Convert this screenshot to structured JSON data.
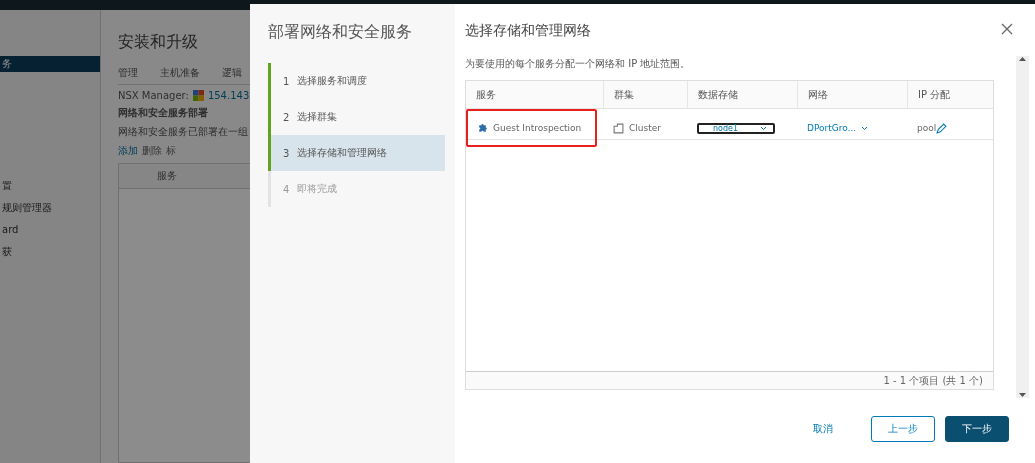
{
  "background": {
    "sidebar": {
      "items": [
        {
          "label": "务",
          "selected": true
        },
        {
          "label": "置",
          "selected": false
        },
        {
          "label": "规则管理器",
          "selected": false
        },
        {
          "label": "ard",
          "selected": false
        },
        {
          "label": "获",
          "selected": false
        }
      ]
    },
    "main": {
      "title": "安装和升级",
      "tabs": [
        "管理",
        "主机准备",
        "逻辑"
      ],
      "manager_label": "NSX Manager:",
      "manager_link": "154.143",
      "section_title": "网络和安全服务部署",
      "section_desc": "网络和安全服务已部署在一组",
      "toolbar": [
        {
          "label": "添加",
          "disabled": false
        },
        {
          "label": "删除",
          "disabled": true
        },
        {
          "label": "标",
          "disabled": true
        }
      ],
      "table_header": "服务"
    }
  },
  "dialog": {
    "title": "部署网络和安全服务",
    "steps": [
      {
        "number": "1",
        "label": "选择服务和调度",
        "selected": false,
        "done": true
      },
      {
        "number": "2",
        "label": "选择群集",
        "selected": false,
        "done": true
      },
      {
        "number": "3",
        "label": "选择存储和管理网络",
        "selected": true,
        "done": true
      },
      {
        "number": "4",
        "label": "即将完成",
        "selected": false,
        "done": false
      }
    ],
    "page_title": "选择存储和管理网络",
    "description": "为要使用的每个服务分配一个网络和 IP 地址范围。",
    "table": {
      "columns": [
        "服务",
        "群集",
        "数据存储",
        "网络",
        "IP 分配"
      ],
      "rows": [
        {
          "service": "Guest Introspection",
          "highlighted": true,
          "cluster": "Cluster",
          "datastore": "node1",
          "network": "DPortGro...",
          "ip": "pool"
        }
      ],
      "footer": "1 - 1 个项目 (共 1 个)"
    },
    "buttons": [
      {
        "label": "取消",
        "kind": "link"
      },
      {
        "label": "上一步",
        "kind": "outline"
      },
      {
        "label": "下一步",
        "kind": "primary"
      }
    ]
  }
}
